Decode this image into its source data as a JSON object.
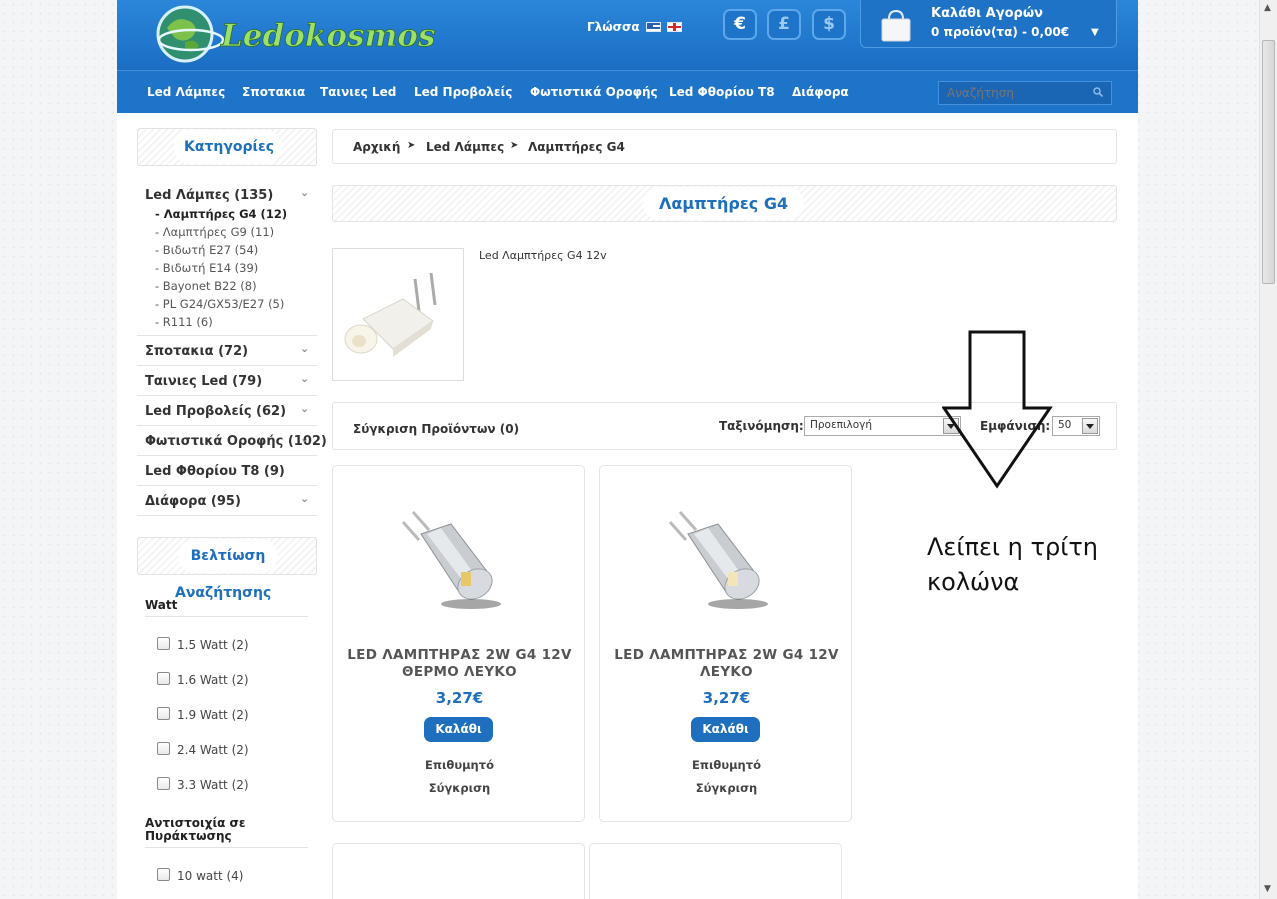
{
  "header": {
    "logo_text": "Ledokosmos",
    "language_label": "Γλώσσα",
    "currencies": [
      "€",
      "£",
      "$"
    ],
    "cart": {
      "title": "Καλάθι Αγορών",
      "summary": "0 προϊόν(τα) - 0,00€"
    },
    "search_placeholder": "Αναζήτηση"
  },
  "nav": {
    "items": [
      "Led Λάμπες",
      "Σποτακια",
      "Ταινιες Led",
      "Led Προβολείς",
      "Φωτιστικά Οροφής",
      "Led Φθορίου T8",
      "Διάφορα"
    ]
  },
  "sidebar": {
    "categories_title": "Κατηγορίες",
    "categories": [
      {
        "label": "Led Λάμπες (135)"
      },
      {
        "label": "Σποτακια (72)"
      },
      {
        "label": "Ταινιες Led (79)"
      },
      {
        "label": "Led Προβολείς (62)"
      },
      {
        "label": "Φωτιστικά Οροφής (102)"
      },
      {
        "label": "Led Φθορίου T8 (9)"
      },
      {
        "label": "Διάφορα (95)"
      }
    ],
    "subcategories": [
      "- Λαμπτήρες G4 (12)",
      "- Λαμπτήρες G9 (11)",
      "- Βιδωτή E27 (54)",
      "- Βιδωτή E14 (39)",
      "- Bayonet B22 (8)",
      "- PL G24/GX53/E27 (5)",
      "- R111 (6)"
    ],
    "refine_title_1": "Βελτίωση",
    "refine_title_2": "Αναζήτησης",
    "filter_watt_title": "Watt",
    "watt_options": [
      "1.5 Watt (2)",
      "1.6 Watt (2)",
      "1.9 Watt (2)",
      "2.4 Watt (2)",
      "3.3 Watt (2)"
    ],
    "filter_equiv_title_1": "Αντιστοιχία σε",
    "filter_equiv_title_2": "Πυράκτωσης",
    "equiv_options": [
      "10 watt (4)"
    ]
  },
  "main": {
    "breadcrumb": [
      "Αρχική",
      "Led Λάμπες",
      "Λαμπτήρες G4"
    ],
    "page_title": "Λαμπτήρες G4",
    "category_description": "Led Λαμπτήρες G4 12v",
    "toolbar": {
      "compare_label": "Σύγκριση Προϊόντων (0)",
      "sort_label": "Ταξινόμηση:",
      "sort_value": "Προεπιλογή",
      "show_label": "Εμφάνιση:",
      "show_value": "50"
    },
    "products": [
      {
        "name_line1": "LED ΛΑΜΠΤΗΡΑΣ 2W G4 12V",
        "name_line2": "ΘΕΡΜΟ ΛΕΥΚΟ",
        "price": "3,27€",
        "button": "Καλάθι",
        "wishlist": "Επιθυμητό",
        "compare": "Σύγκριση"
      },
      {
        "name_line1": "LED ΛΑΜΠΤΗΡΑΣ 2W G4 12V",
        "name_line2": "ΛΕΥΚΟ",
        "price": "3,27€",
        "button": "Καλάθι",
        "wishlist": "Επιθυμητό",
        "compare": "Σύγκριση"
      }
    ]
  },
  "annotation": {
    "line1": "Λείπει η τρίτη",
    "line2": "κολώνα"
  }
}
